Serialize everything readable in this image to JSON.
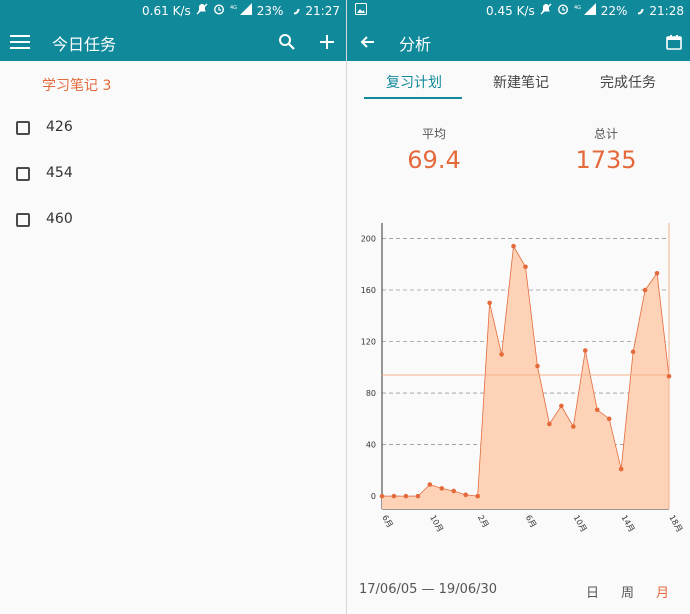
{
  "left": {
    "status": {
      "speed": "0.61 K/s",
      "battery": "23%",
      "time": "21:27"
    },
    "toolbar": {
      "title": "今日任务"
    },
    "group_title": "学习笔记 3",
    "tasks": [
      {
        "label": "426"
      },
      {
        "label": "454"
      },
      {
        "label": "460"
      }
    ]
  },
  "right": {
    "status": {
      "speed": "0.45 K/s",
      "battery": "22%",
      "time": "21:28"
    },
    "toolbar": {
      "title": "分析"
    },
    "tabs": [
      {
        "label": "复习计划",
        "active": true
      },
      {
        "label": "新建笔记",
        "active": false
      },
      {
        "label": "完成任务",
        "active": false
      }
    ],
    "stats": {
      "avg_label": "平均",
      "avg_value": "69.4",
      "total_label": "总计",
      "total_value": "1735"
    },
    "footer": {
      "range": "17/06/05 — 19/06/30",
      "periods": [
        "日",
        "周",
        "月"
      ],
      "active_period": "月"
    }
  },
  "colors": {
    "primary": "#10899a",
    "accent": "#e46a3c",
    "area_fill": "#fdd2b6"
  },
  "chart_data": {
    "type": "area",
    "x_ticks": [
      "6月",
      "10月",
      "2月",
      "6月",
      "10月",
      "14月",
      "18月"
    ],
    "y_ticks": [
      0,
      40,
      80,
      120,
      160,
      200
    ],
    "ylim": [
      -10,
      212
    ],
    "average_line": 94,
    "values": [
      0,
      0,
      0,
      0,
      9,
      6,
      4,
      1,
      0,
      150,
      110,
      194,
      178,
      101,
      56,
      70,
      54,
      113,
      67,
      60,
      21,
      112,
      160,
      173,
      93
    ],
    "grid": true
  }
}
